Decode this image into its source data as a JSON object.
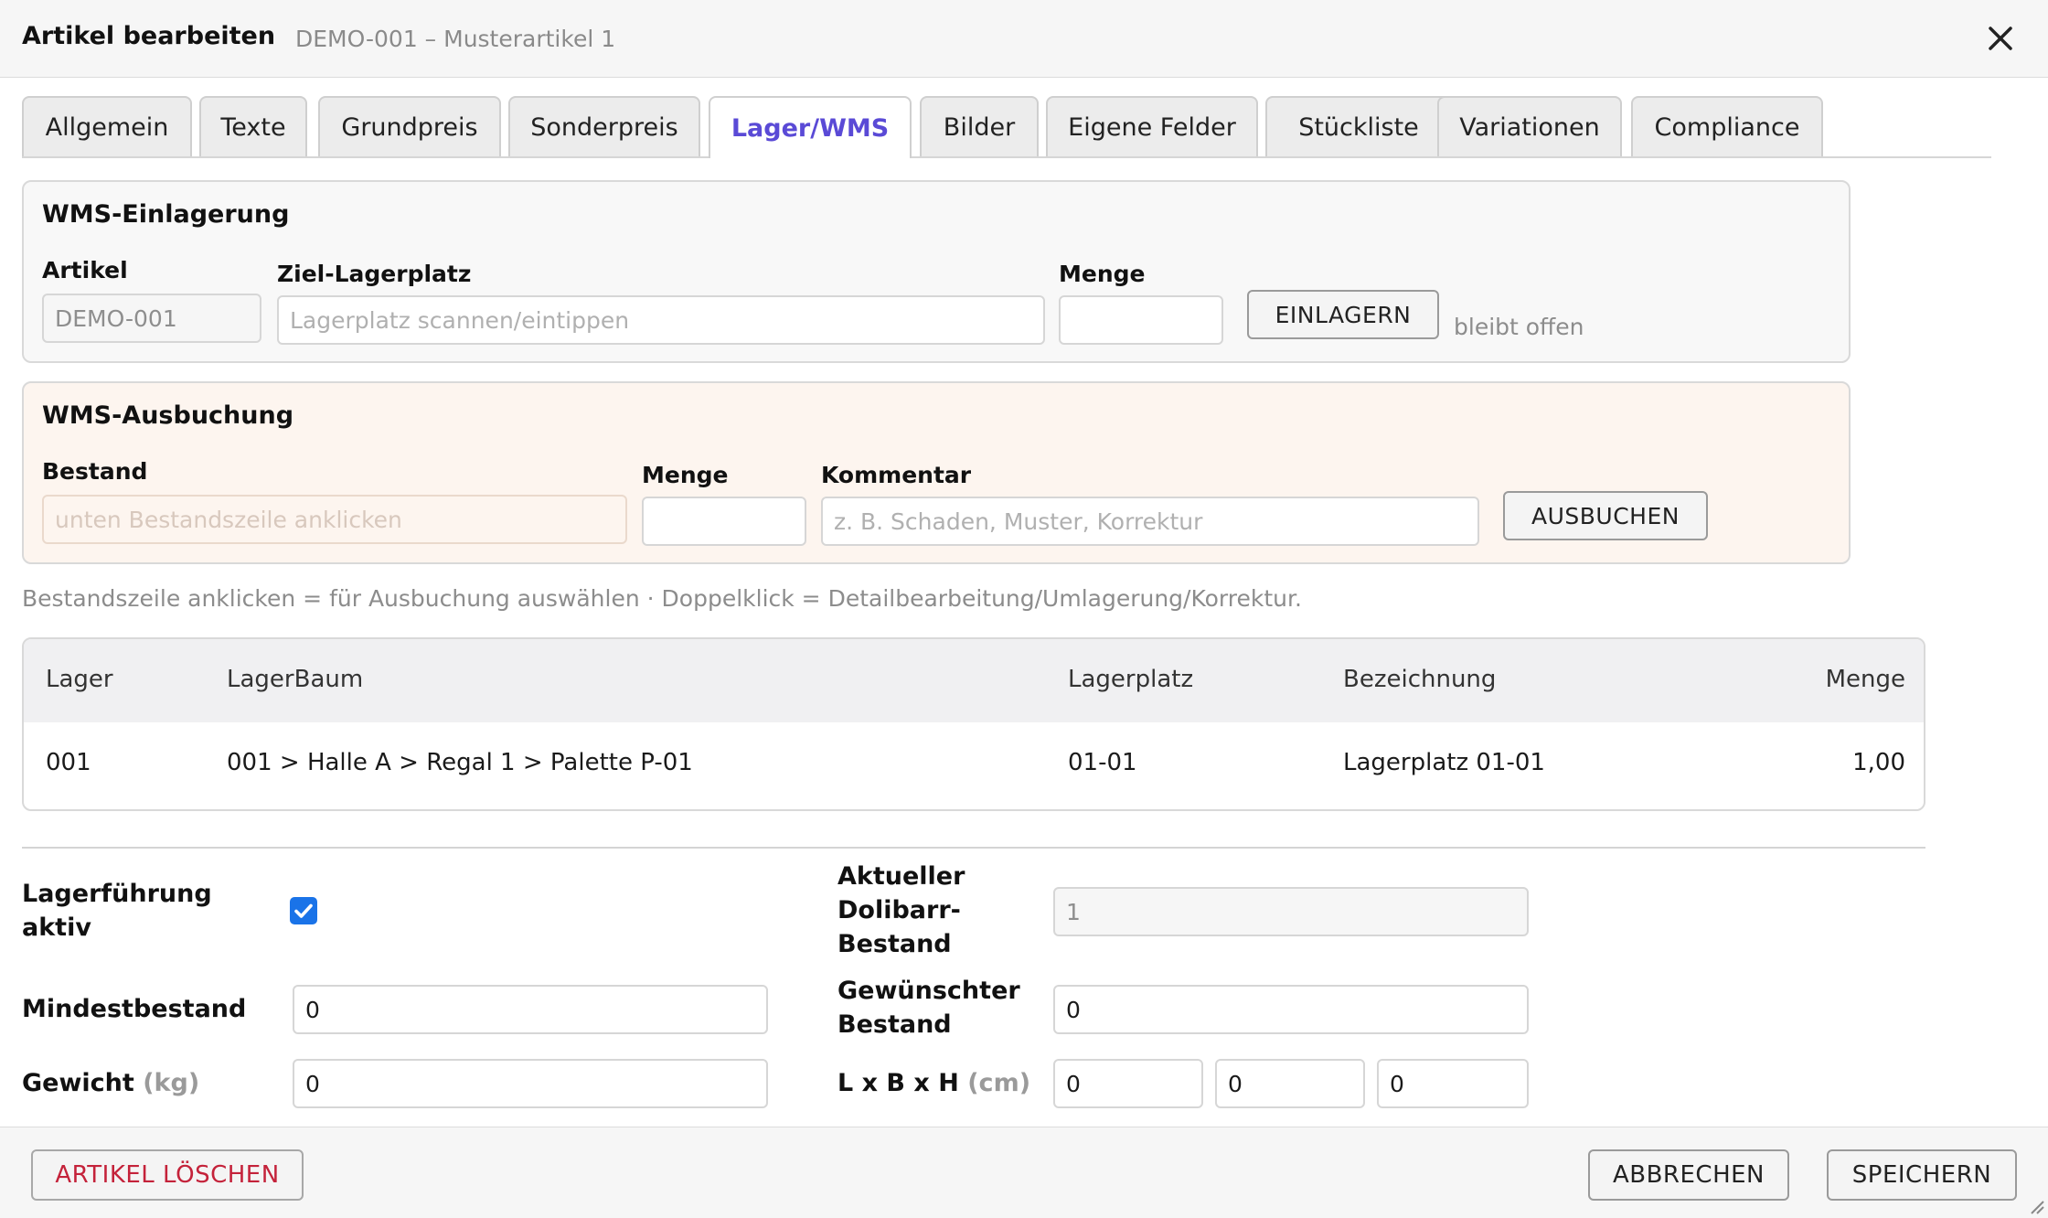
{
  "header": {
    "title": "Artikel bearbeiten",
    "subtitle": "DEMO-001 – Musterartikel 1"
  },
  "tabs": [
    {
      "label": "Allgemein",
      "active": false
    },
    {
      "label": "Texte",
      "active": false
    },
    {
      "label": "Grundpreis",
      "active": false
    },
    {
      "label": "Sonderpreis",
      "active": false
    },
    {
      "label": "Lager/WMS",
      "active": true
    },
    {
      "label": "Bilder",
      "active": false
    },
    {
      "label": "Eigene Felder",
      "active": false
    },
    {
      "label": "Stückliste",
      "active": false
    },
    {
      "label": "Variationen",
      "active": false
    },
    {
      "label": "Compliance",
      "active": false
    }
  ],
  "einlagerung": {
    "title": "WMS-Einlagerung",
    "artikel_label": "Artikel",
    "artikel_value": "DEMO-001",
    "ziel_label": "Ziel-Lagerplatz",
    "ziel_placeholder": "Lagerplatz scannen/eintippen",
    "menge_label": "Menge",
    "menge_value": "",
    "button": "EINLAGERN",
    "status": "bleibt offen"
  },
  "ausbuchung": {
    "title": "WMS-Ausbuchung",
    "bestand_label": "Bestand",
    "bestand_placeholder": "unten Bestandszeile anklicken",
    "menge_label": "Menge",
    "menge_value": "",
    "kommentar_label": "Kommentar",
    "kommentar_placeholder": "z. B. Schaden, Muster, Korrektur",
    "button": "AUSBUCHEN"
  },
  "hint": "Bestandszeile anklicken = für Ausbuchung auswählen · Doppelklick = Detailbearbeitung/Umlagerung/Korrektur.",
  "stock_table": {
    "columns": [
      "Lager",
      "LagerBaum",
      "Lagerplatz",
      "Bezeichnung",
      "Menge"
    ],
    "rows": [
      [
        "001",
        "001 > Halle A > Regal 1 > Palette P-01",
        "01-01",
        "Lagerplatz 01-01",
        "1,00"
      ]
    ]
  },
  "fields": {
    "lagerfuehrung_label_1": "Lagerführung",
    "lagerfuehrung_label_2": "aktiv",
    "lagerfuehrung_checked": true,
    "aktueller_label_1": "Aktueller",
    "aktueller_label_2": "Dolibarr-",
    "aktueller_label_3": "Bestand",
    "aktueller_value": "1",
    "mindestbestand_label": "Mindestbestand",
    "mindestbestand_value": "0",
    "gewuenscht_label_1": "Gewünschter",
    "gewuenscht_label_2": "Bestand",
    "gewuenscht_value": "0",
    "gewicht_label": "Gewicht",
    "gewicht_unit": "(kg)",
    "gewicht_value": "0",
    "dims_label": "L x B x H",
    "dims_unit": "(cm)",
    "dims_l": "0",
    "dims_b": "0",
    "dims_h": "0"
  },
  "footer": {
    "delete": "ARTIKEL LÖSCHEN",
    "cancel": "ABBRECHEN",
    "save": "SPEICHERN"
  },
  "colors": {
    "accent": "#5a4ad6",
    "danger": "#c4223a",
    "checkbox": "#1a73e8",
    "ausbuchung_bg": "#fdf5ef"
  }
}
